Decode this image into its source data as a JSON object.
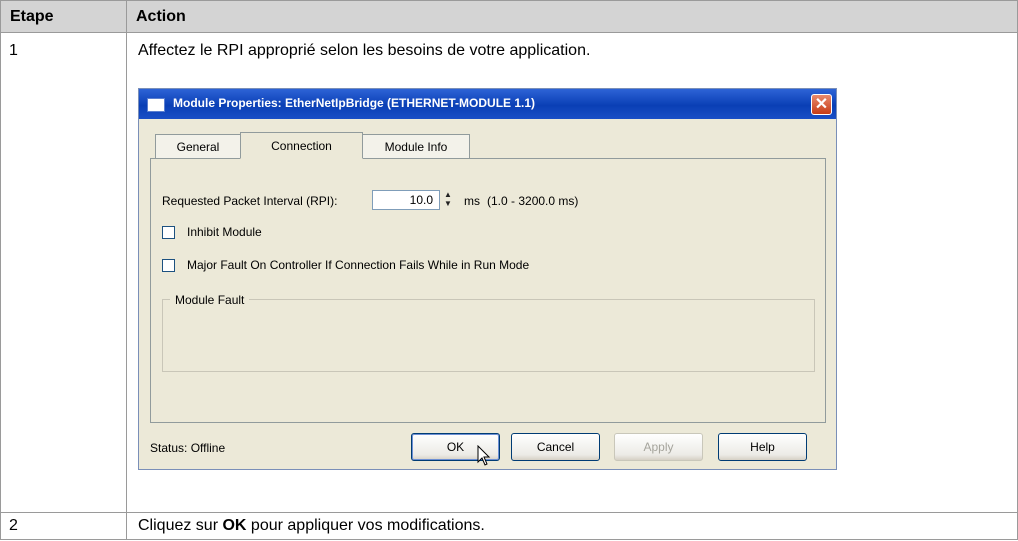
{
  "table": {
    "header": {
      "col1": "Etape",
      "col2": "Action"
    },
    "rows": [
      {
        "step": "1",
        "action": "Affectez le RPI approprié selon les besoins de votre application."
      },
      {
        "step": "2",
        "action_prefix": "Cliquez sur ",
        "action_bold": "OK",
        "action_suffix": " pour appliquer vos modifications."
      }
    ]
  },
  "dialog": {
    "title": "Module Properties: EtherNetIpBridge (ETHERNET-MODULE 1.1)",
    "close_icon": "close-icon",
    "tabs": [
      "General",
      "Connection",
      "Module Info"
    ],
    "active_tab": "Connection",
    "rpi_label": "Requested Packet Interval (RPI):",
    "rpi_value": "10.0",
    "rpi_unit": "ms",
    "rpi_range": "(1.0 - 3200.0 ms)",
    "inhibit_label": "Inhibit Module",
    "inhibit_checked": false,
    "major_fault_label": "Major Fault On Controller If Connection Fails While in Run Mode",
    "major_fault_checked": false,
    "module_fault_label": "Module Fault",
    "status": "Status: Offline",
    "buttons": {
      "ok": "OK",
      "cancel": "Cancel",
      "apply": "Apply",
      "help": "Help"
    },
    "apply_disabled": true,
    "colors": {
      "titlebar": "#0a3fb5",
      "close": "#c73c16",
      "dialog_bg": "#ece9d8"
    }
  }
}
